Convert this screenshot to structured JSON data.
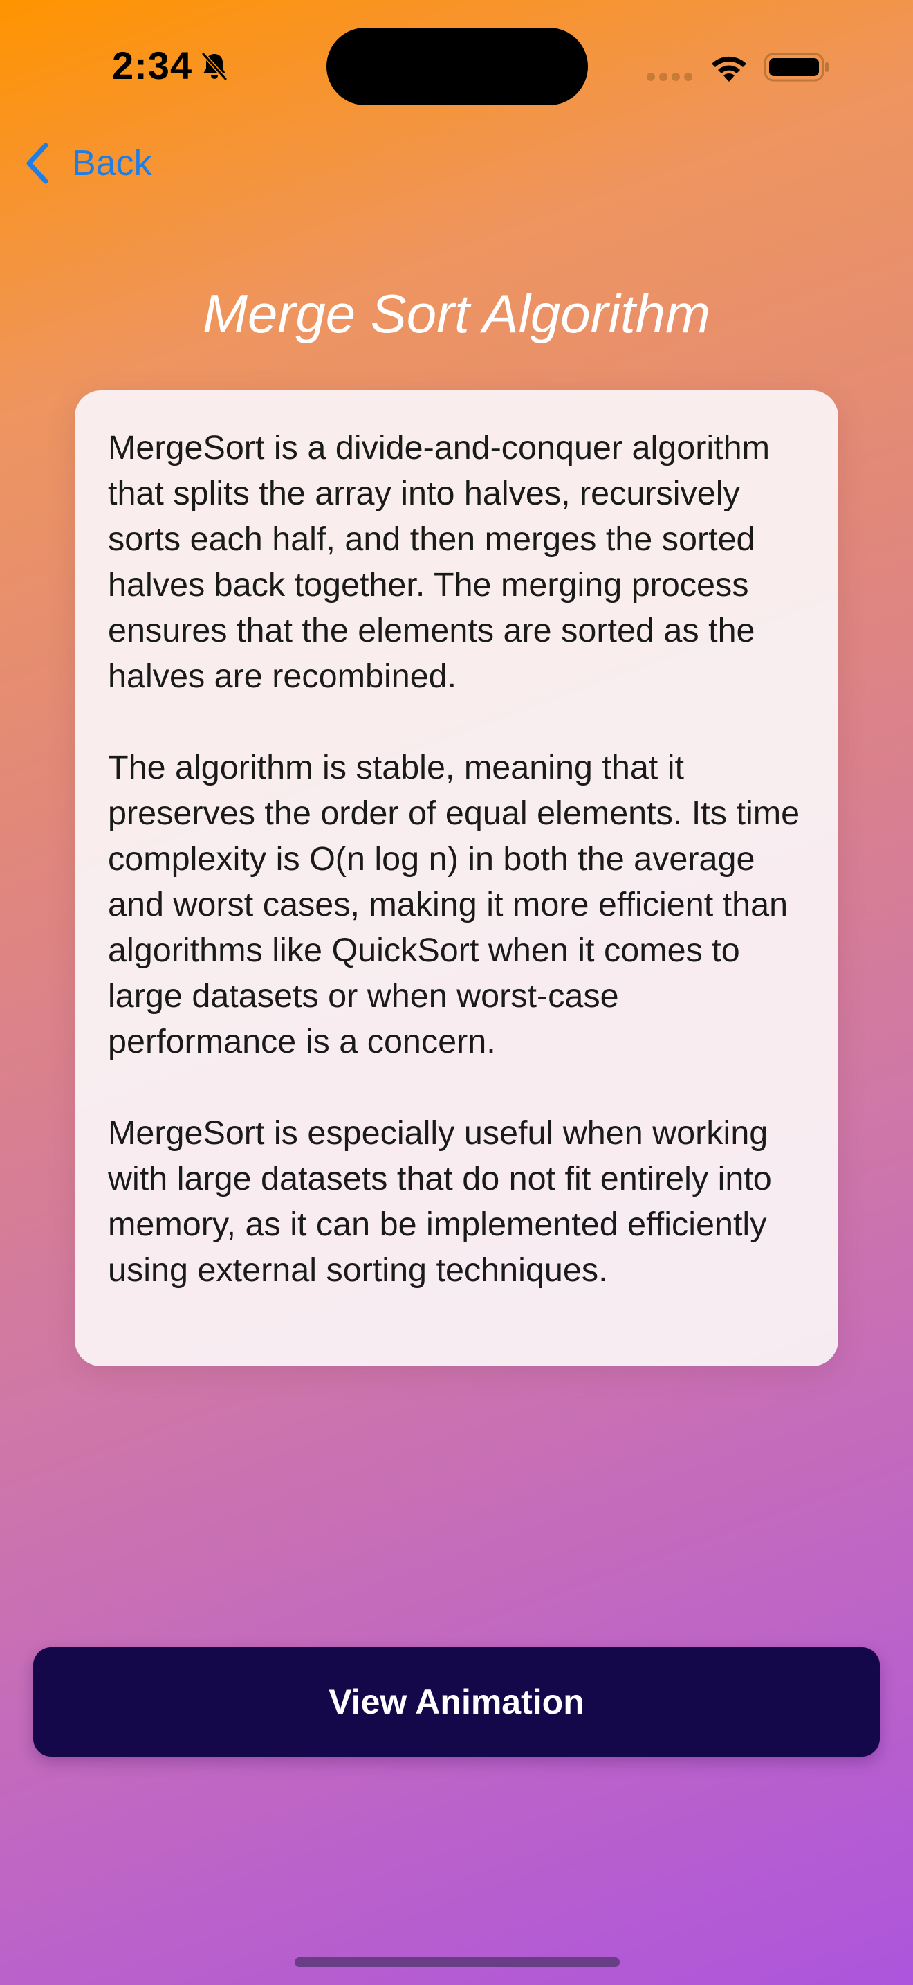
{
  "status_bar": {
    "time": "2:34",
    "icons": [
      "bell-slash-icon",
      "signal-icon",
      "wifi-icon",
      "battery-icon"
    ]
  },
  "nav": {
    "back_label": "Back",
    "back_icon": "chevron-left-icon"
  },
  "page": {
    "title": "Merge Sort Algorithm"
  },
  "description": {
    "paragraphs": [
      "MergeSort is a divide-and-conquer algorithm that splits the array into halves, recursively sorts each half, and then merges the sorted halves back together. The merging process ensures that the elements are sorted as the halves are recombined.",
      "The algorithm is stable, meaning that it preserves the order of equal elements. Its time complexity is O(n log n) in both the average and worst cases, making it more efficient than algorithms like QuickSort when it comes to large datasets or when worst-case performance is a concern.",
      "MergeSort is especially useful when working with large datasets that do not fit entirely into memory, as it can be implemented efficiently using external sorting techniques."
    ]
  },
  "actions": {
    "view_animation_label": "View Animation"
  },
  "colors": {
    "gradient_top": "#FF9400",
    "gradient_bottom": "#AD55DC",
    "accent_link": "#1E7EE8",
    "button_bg": "#14084A",
    "card_bg": "#FAF3F5"
  }
}
